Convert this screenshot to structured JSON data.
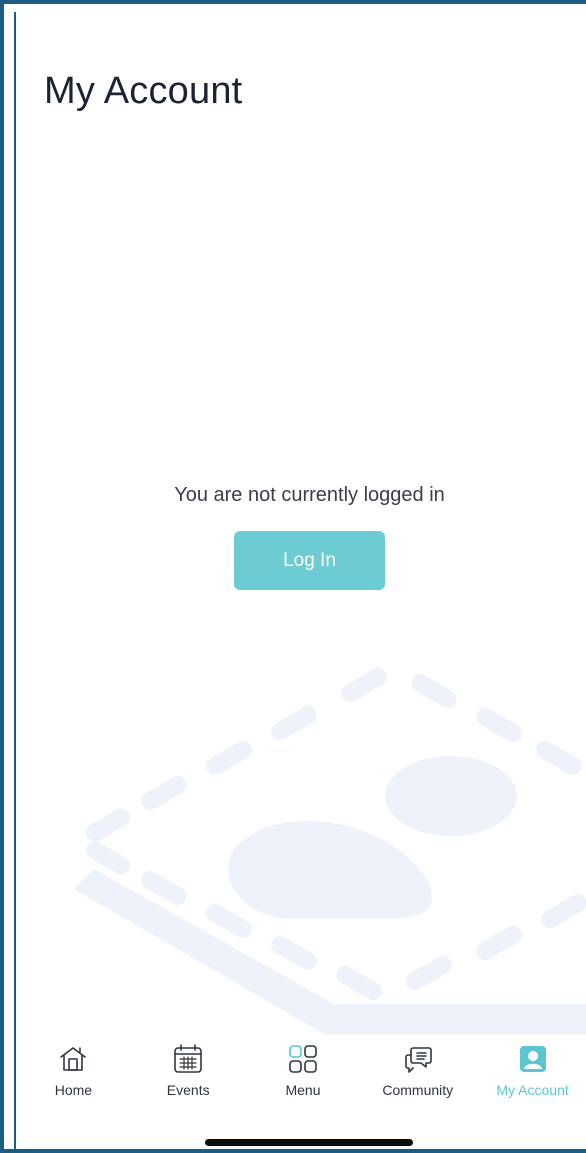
{
  "screen": {
    "title": "My Account"
  },
  "login": {
    "message": "You are not currently logged in",
    "button_label": "Log In"
  },
  "tabbar": {
    "tabs": [
      {
        "label": "Home",
        "icon": "home-icon",
        "active": false
      },
      {
        "label": "Events",
        "icon": "calendar-icon",
        "active": false
      },
      {
        "label": "Menu",
        "icon": "grid-icon",
        "active": false
      },
      {
        "label": "Community",
        "icon": "chat-bubbles-icon",
        "active": false
      },
      {
        "label": "My Account",
        "icon": "account-icon",
        "active": true
      }
    ]
  },
  "colors": {
    "accent": "#6dcbd4",
    "accent_text": "#5cc5cf",
    "title_text": "#1b2433",
    "frame_border": "#1c5d83",
    "illustration": "#eef3fb"
  }
}
